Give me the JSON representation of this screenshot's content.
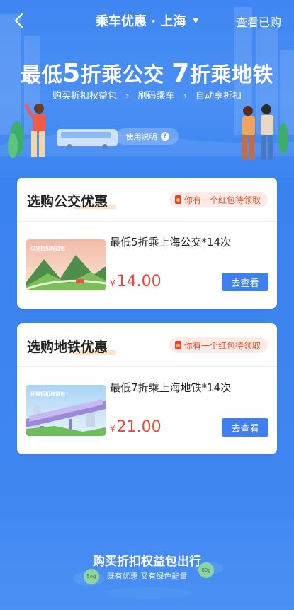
{
  "nav": {
    "title": "乘车优惠 · 上海",
    "right_link": "查看已购"
  },
  "banner": {
    "headline_parts": [
      "最低",
      "5",
      "折乘公交 ",
      "7",
      "折乘地铁"
    ],
    "steps": [
      "购买折扣权益包",
      "刷码乘车",
      "自动享折扣"
    ],
    "help_label": "使用说明",
    "help_icon": "?"
  },
  "bus_card": {
    "title": "选购公交优惠",
    "redpack_text": "你有一个红包待领取",
    "item_thumb_label": "公交折扣权益包",
    "item_name": "最低5折乘上海公交*14次",
    "currency": "¥",
    "price": "14.00",
    "button": "去查看"
  },
  "metro_card": {
    "title": "选购地铁优惠",
    "redpack_text": "你有一个红包待领取",
    "item_thumb_label": "地铁折扣权益包",
    "item_name": "最低7折乘上海地铁*14次",
    "currency": "¥",
    "price": "21.00",
    "button": "去查看"
  },
  "footer": {
    "slogan": "购买折扣权益包出行",
    "sub": "既有优惠 又有绿色能量",
    "badge_left": "5og",
    "badge_right": "80g"
  },
  "colors": {
    "primary": "#3f86f2",
    "price": "#e54b3c",
    "button": "#3f7ff0",
    "redpack_bg": "#fdebe7"
  }
}
